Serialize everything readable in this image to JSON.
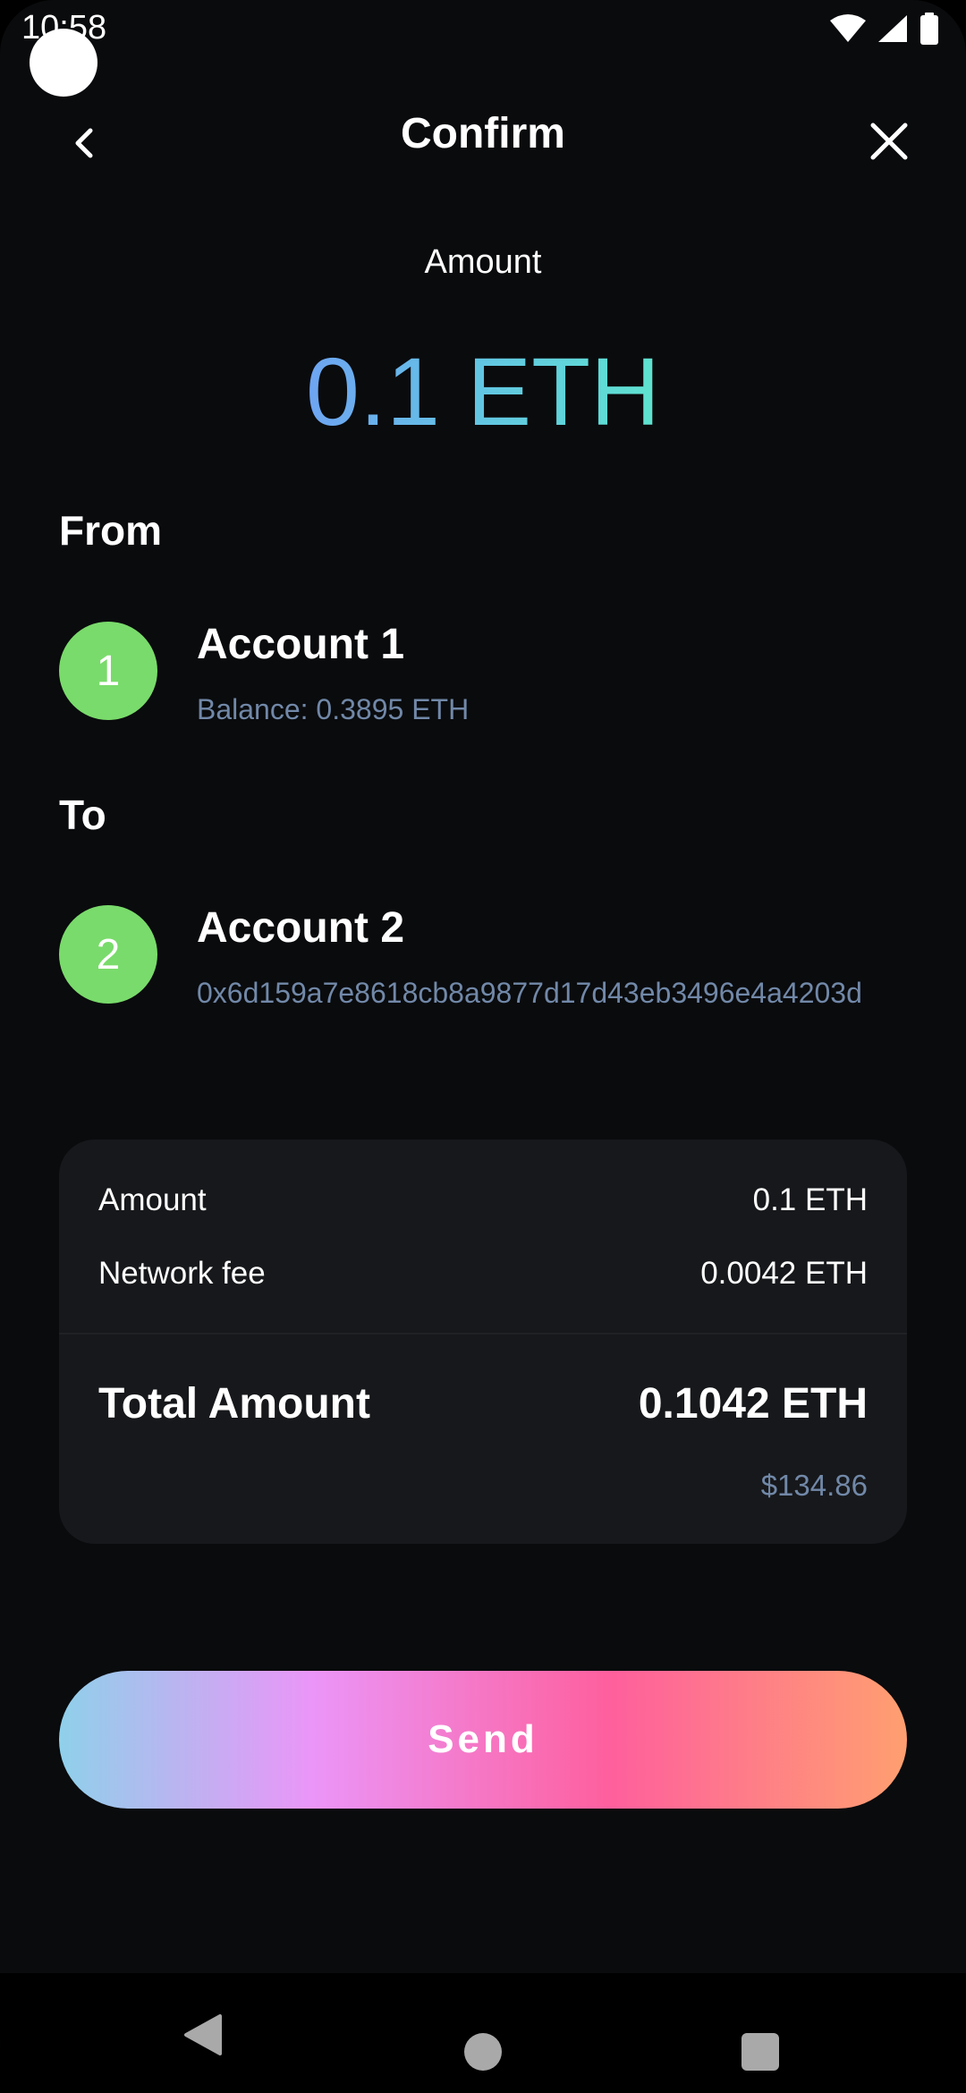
{
  "status_bar": {
    "time": "10:58",
    "icons": [
      "wifi-icon",
      "signal-icon",
      "battery-icon"
    ]
  },
  "header": {
    "title": "Confirm",
    "back_icon": "chevron-left-icon",
    "close_icon": "close-icon"
  },
  "amount": {
    "label": "Amount",
    "value": "0.1 ETH"
  },
  "from": {
    "label": "From",
    "avatar": "1",
    "account_name": "Account 1",
    "balance": "Balance: 0.3895 ETH"
  },
  "to": {
    "label": "To",
    "avatar": "2",
    "account_name": "Account 2",
    "address": "0x6d159a7e8618cb8a9877d17d43eb3496e4a4203d"
  },
  "summary": {
    "amount_label": "Amount",
    "amount_value": "0.1 ETH",
    "fee_label": "Network fee",
    "fee_value": "0.0042 ETH",
    "total_label": "Total Amount",
    "total_value": "0.1042 ETH",
    "fiat_value": "$134.86"
  },
  "send_button": {
    "label": "Send"
  },
  "colors": {
    "background": "#0a0b0d",
    "card": "#17181b",
    "avatar": "#79db6b",
    "muted_text": "#7188a8",
    "amount_gradient": [
      "#6ea4f2",
      "#5fe3cf"
    ],
    "send_gradient": [
      "#8fd0ea",
      "#eb95f8",
      "#fe5f9d",
      "#ff9f70"
    ]
  },
  "nav_bar": {
    "icons": [
      "nav-back-icon",
      "nav-home-icon",
      "nav-recents-icon"
    ]
  }
}
